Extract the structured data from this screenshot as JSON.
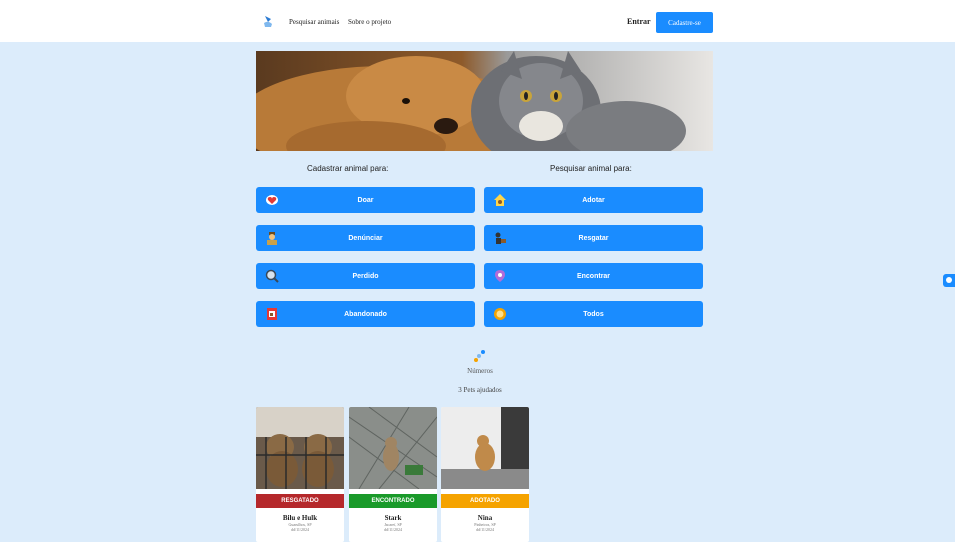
{
  "header": {
    "nav": [
      "Pesquisar animais",
      "Sobre o projeto"
    ],
    "login_label": "Entrar",
    "signup_label": "Cadastre-se"
  },
  "main": {
    "register_title": "Cadastrar animal para:",
    "search_title": "Pesquisar animal para:",
    "register_buttons": [
      {
        "label": "Doar",
        "icon": "heart-icon"
      },
      {
        "label": "Denúnciar",
        "icon": "officer-icon"
      },
      {
        "label": "Perdido",
        "icon": "magnifier-icon"
      },
      {
        "label": "Abandonado",
        "icon": "sign-icon"
      }
    ],
    "search_buttons": [
      {
        "label": "Adotar",
        "icon": "home-icon"
      },
      {
        "label": "Resgatar",
        "icon": "rescue-icon"
      },
      {
        "label": "Encontrar",
        "icon": "location-pin-icon"
      },
      {
        "label": "Todos",
        "icon": "paw-circle-icon"
      }
    ]
  },
  "stats": {
    "label": "Números",
    "pets_helped": "3 Pets ajudados"
  },
  "cards": [
    {
      "status": "RESGATADO",
      "status_color": "#b5282b",
      "name": "Bilu e Hulk",
      "city": "Guarulhos, SP",
      "date": "dd/11/2024"
    },
    {
      "status": "ENCONTRADO",
      "status_color": "#1a9a2a",
      "name": "Stark",
      "city": "Jacareí, SP",
      "date": "dd/11/2024"
    },
    {
      "status": "ADOTADO",
      "status_color": "#f5a300",
      "name": "Nina",
      "city": "Pinheiros, SP",
      "date": "dd/11/2024"
    }
  ],
  "colors": {
    "primary": "#1a8cff",
    "background": "#dcecfb"
  }
}
